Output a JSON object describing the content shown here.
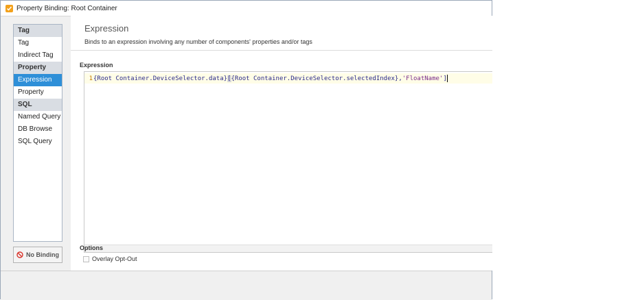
{
  "window": {
    "title": "Property Binding: Root Container"
  },
  "sidebar": {
    "sections": [
      {
        "header": "Tag",
        "items": [
          "Tag",
          "Indirect Tag"
        ]
      },
      {
        "header": "Property",
        "items": [
          "Expression",
          "Property"
        ]
      },
      {
        "header": "SQL",
        "items": [
          "Named Query",
          "DB Browse",
          "SQL Query"
        ]
      }
    ],
    "selected": "Expression",
    "no_binding_label": "No Binding"
  },
  "main": {
    "title": "Expression",
    "description": "Binds to an expression involving any number of components' properties and/or tags",
    "expression_label": "Expression",
    "editor": {
      "line_number": "1",
      "code_part1": "{Root Container.DeviceSelector.data}",
      "code_part2": "[",
      "code_part3": "{Root Container.DeviceSelector.selectedIndex},",
      "code_string": "'FloatName'",
      "code_part4": "]"
    },
    "options_label": "Options",
    "overlay_optout_label": "Overlay Opt-Out",
    "overlay_optout_checked": false
  },
  "colors": {
    "selected_item": "#2e8fd8",
    "title_icon": "#f3a11b",
    "no_binding_icon": "#d9342b"
  }
}
